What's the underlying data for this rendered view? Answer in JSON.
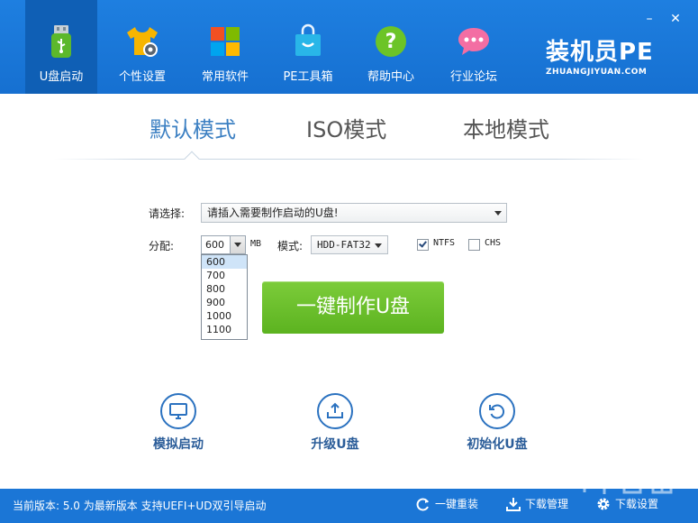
{
  "nav": {
    "items": [
      {
        "label": "U盘启动",
        "icon": "usb-drive-icon",
        "active": true
      },
      {
        "label": "个性设置",
        "icon": "tshirt-gear-icon"
      },
      {
        "label": "常用软件",
        "icon": "windows-tiles-icon"
      },
      {
        "label": "PE工具箱",
        "icon": "toolbox-bag-icon"
      },
      {
        "label": "帮助中心",
        "icon": "help-question-icon"
      },
      {
        "label": "行业论坛",
        "icon": "chat-bubble-icon"
      }
    ]
  },
  "brand": {
    "main": "装机员PE",
    "sub": "ZHUANGJIYUAN.COM"
  },
  "window": {
    "minimize": "–",
    "close": "✕"
  },
  "tabs": [
    {
      "label": "默认模式",
      "active": true
    },
    {
      "label": "ISO模式"
    },
    {
      "label": "本地模式"
    }
  ],
  "form": {
    "select_label": "请选择:",
    "usb_select_value": "请插入需要制作启动的U盘!",
    "alloc_label": "分配:",
    "size_value": "600",
    "size_unit": "MB",
    "size_options": [
      "600",
      "700",
      "800",
      "900",
      "1000",
      "1100"
    ],
    "mode_label": "模式:",
    "mode_value": "HDD-FAT32",
    "ntfs_label": "NTFS",
    "ntfs_checked": true,
    "chs_label": "CHS",
    "chs_checked": false,
    "make_button": "一键制作U盘"
  },
  "actions": [
    {
      "label": "模拟启动",
      "icon": "monitor-icon"
    },
    {
      "label": "升级U盘",
      "icon": "upload-tray-icon"
    },
    {
      "label": "初始化U盘",
      "icon": "refresh-icon"
    }
  ],
  "status": {
    "version_text": "当前版本: 5.0 为最新版本 支持UEFI+UD双引导启动",
    "reinstall": "一键重装",
    "download_manage": "下载管理",
    "download_settings": "下载设置"
  },
  "colors": {
    "header": "#1670d1",
    "accent_blue": "#3b7fc2",
    "make_button_green": "#5cb320",
    "status_bar": "#1b76d6"
  }
}
